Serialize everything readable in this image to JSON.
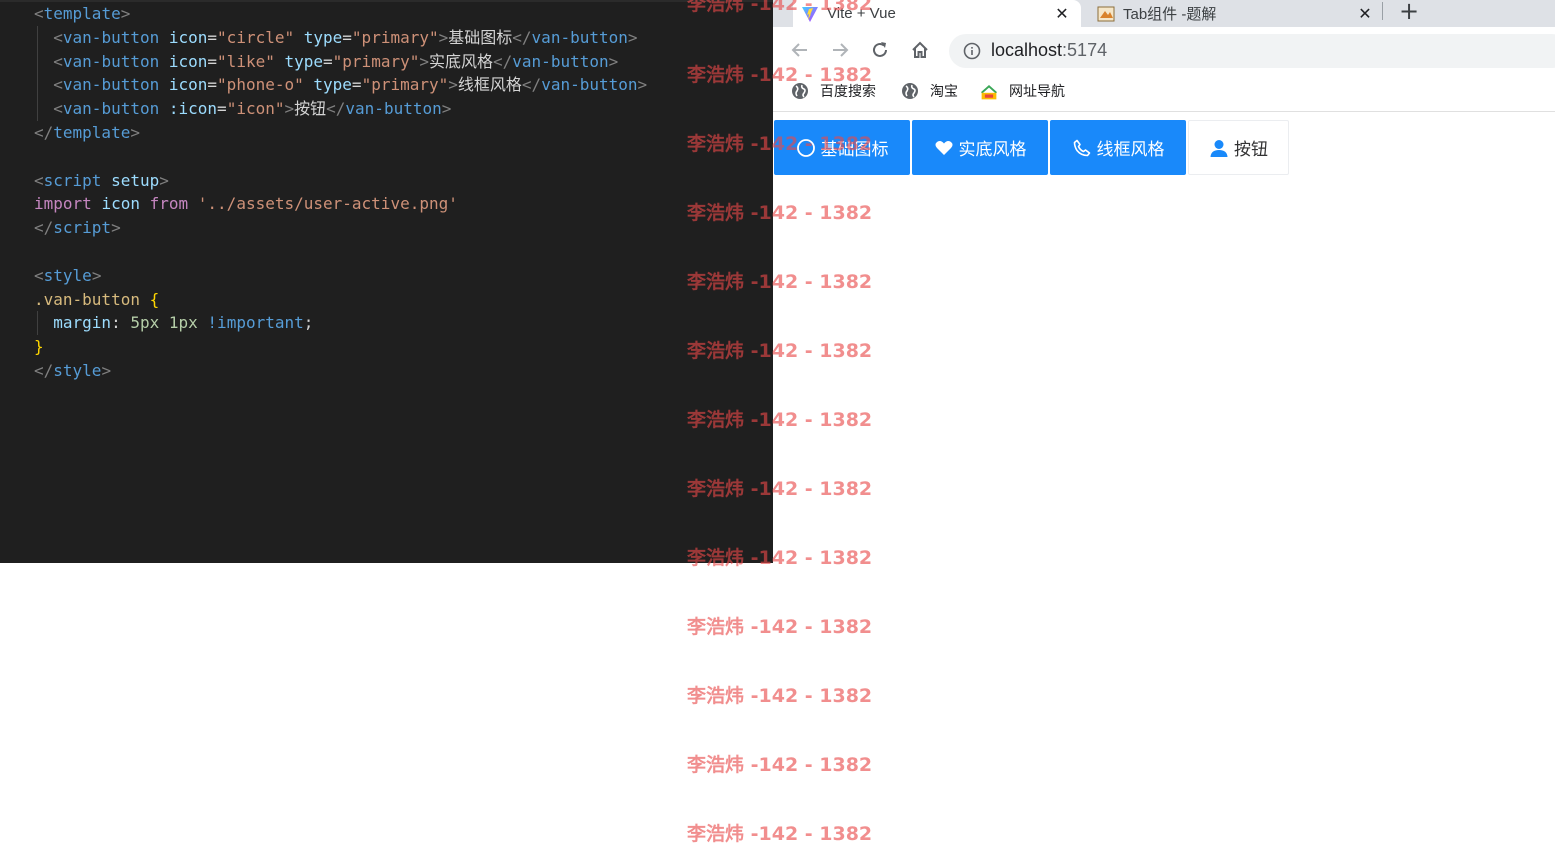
{
  "editor": {
    "lines": [
      [
        [
          "t-punc",
          "<"
        ],
        [
          "t-tag",
          "template"
        ],
        [
          "t-punc",
          ">"
        ]
      ],
      [
        [
          "t-text",
          "  "
        ],
        [
          "t-punc",
          "<"
        ],
        [
          "t-tag",
          "van-button"
        ],
        [
          "t-text",
          " "
        ],
        [
          "t-attr",
          "icon"
        ],
        [
          "t-eq",
          "="
        ],
        [
          "t-str",
          "\"circle\""
        ],
        [
          "t-text",
          " "
        ],
        [
          "t-attr",
          "type"
        ],
        [
          "t-eq",
          "="
        ],
        [
          "t-str",
          "\"primary\""
        ],
        [
          "t-punc",
          ">"
        ],
        [
          "t-text",
          "基础图标"
        ],
        [
          "t-punc",
          "</"
        ],
        [
          "t-tag",
          "van-button"
        ],
        [
          "t-punc",
          ">"
        ]
      ],
      [
        [
          "t-text",
          "  "
        ],
        [
          "t-punc",
          "<"
        ],
        [
          "t-tag",
          "van-button"
        ],
        [
          "t-text",
          " "
        ],
        [
          "t-attr",
          "icon"
        ],
        [
          "t-eq",
          "="
        ],
        [
          "t-str",
          "\"like\""
        ],
        [
          "t-text",
          " "
        ],
        [
          "t-attr",
          "type"
        ],
        [
          "t-eq",
          "="
        ],
        [
          "t-str",
          "\"primary\""
        ],
        [
          "t-punc",
          ">"
        ],
        [
          "t-text",
          "实底风格"
        ],
        [
          "t-punc",
          "</"
        ],
        [
          "t-tag",
          "van-button"
        ],
        [
          "t-punc",
          ">"
        ]
      ],
      [
        [
          "t-text",
          "  "
        ],
        [
          "t-punc",
          "<"
        ],
        [
          "t-tag",
          "van-button"
        ],
        [
          "t-text",
          " "
        ],
        [
          "t-attr",
          "icon"
        ],
        [
          "t-eq",
          "="
        ],
        [
          "t-str",
          "\"phone-o\""
        ],
        [
          "t-text",
          " "
        ],
        [
          "t-attr",
          "type"
        ],
        [
          "t-eq",
          "="
        ],
        [
          "t-str",
          "\"primary\""
        ],
        [
          "t-punc",
          ">"
        ],
        [
          "t-text",
          "线框风格"
        ],
        [
          "t-punc",
          "</"
        ],
        [
          "t-tag",
          "van-button"
        ],
        [
          "t-punc",
          ">"
        ]
      ],
      [
        [
          "t-text",
          "  "
        ],
        [
          "t-punc",
          "<"
        ],
        [
          "t-tag",
          "van-button"
        ],
        [
          "t-text",
          " "
        ],
        [
          "t-attr",
          ":icon"
        ],
        [
          "t-eq",
          "="
        ],
        [
          "t-str",
          "\"icon\""
        ],
        [
          "t-punc",
          ">"
        ],
        [
          "t-text",
          "按钮"
        ],
        [
          "t-punc",
          "</"
        ],
        [
          "t-tag",
          "van-button"
        ],
        [
          "t-punc",
          ">"
        ]
      ],
      [
        [
          "t-punc",
          "</"
        ],
        [
          "t-tag",
          "template"
        ],
        [
          "t-punc",
          ">"
        ]
      ],
      [],
      [
        [
          "t-punc",
          "<"
        ],
        [
          "t-tag",
          "script"
        ],
        [
          "t-text",
          " "
        ],
        [
          "t-attr",
          "setup"
        ],
        [
          "t-punc",
          ">"
        ]
      ],
      [
        [
          "t-kw",
          "import"
        ],
        [
          "t-text",
          " "
        ],
        [
          "t-attr",
          "icon"
        ],
        [
          "t-text",
          " "
        ],
        [
          "t-kw",
          "from"
        ],
        [
          "t-text",
          " "
        ],
        [
          "t-str",
          "'../assets/user-active.png'"
        ]
      ],
      [
        [
          "t-punc",
          "</"
        ],
        [
          "t-tag",
          "script"
        ],
        [
          "t-punc",
          ">"
        ]
      ],
      [],
      [
        [
          "t-punc",
          "<"
        ],
        [
          "t-tag",
          "style"
        ],
        [
          "t-punc",
          ">"
        ]
      ],
      [
        [
          "t-sel",
          ".van-button"
        ],
        [
          "t-text",
          " "
        ],
        [
          "t-brace",
          "{"
        ]
      ],
      [
        [
          "t-text",
          "  "
        ],
        [
          "t-prop",
          "margin"
        ],
        [
          "t-text",
          ": "
        ],
        [
          "t-num",
          "5px"
        ],
        [
          "t-text",
          " "
        ],
        [
          "t-num",
          "1px"
        ],
        [
          "t-text",
          " "
        ],
        [
          "t-imp",
          "!important"
        ],
        [
          "t-text",
          ";"
        ]
      ],
      [
        [
          "t-brace",
          "}"
        ]
      ],
      [
        [
          "t-punc",
          "</"
        ],
        [
          "t-tag",
          "style"
        ],
        [
          "t-punc",
          ">"
        ]
      ]
    ]
  },
  "browser": {
    "tabs": [
      {
        "title": "Vite + Vue",
        "close": "✕",
        "active": true
      },
      {
        "title": "Tab组件 -题解",
        "close": "✕",
        "active": false
      }
    ],
    "new_tab": "+",
    "address": {
      "host": "localhost",
      "port": ":5174"
    },
    "bookmarks": [
      {
        "label": "百度搜索",
        "icon": "globe-icon"
      },
      {
        "label": "淘宝",
        "icon": "globe-icon"
      },
      {
        "label": "网址导航",
        "icon": "2345-icon"
      }
    ]
  },
  "buttons": [
    {
      "label": "基础图标",
      "icon": "circle-icon",
      "type": "primary"
    },
    {
      "label": "实底风格",
      "icon": "like-icon",
      "type": "primary"
    },
    {
      "label": "线框风格",
      "icon": "phone-icon",
      "type": "primary"
    },
    {
      "label": "按钮",
      "icon": "user-icon",
      "type": "default"
    }
  ],
  "watermark": {
    "text": "李浩炜 -142 - 1382",
    "repeat_count": 13
  },
  "colors": {
    "primary": "#1989fa",
    "editor_bg": "#1f1f1f",
    "watermark": "#e84848"
  }
}
